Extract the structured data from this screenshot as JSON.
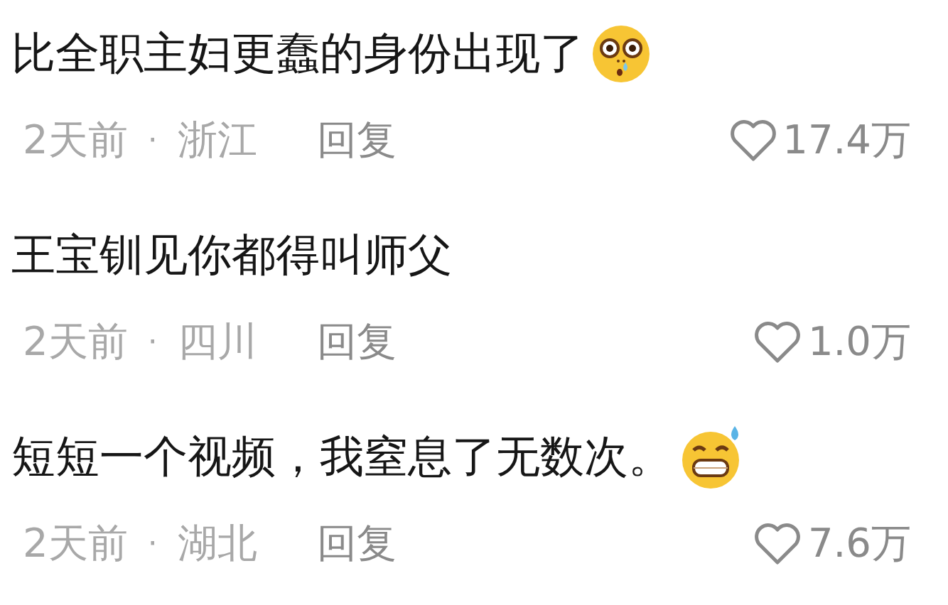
{
  "comments": [
    {
      "text": "比全职主妇更蠢的身份出现了",
      "time": "2天前",
      "separator": "·",
      "location": "浙江",
      "reply": "回复",
      "likes": "17.4万"
    },
    {
      "text": "王宝钏见你都得叫师父",
      "time": "2天前",
      "separator": "·",
      "location": "四川",
      "reply": "回复",
      "likes": "1.0万"
    },
    {
      "text": "短短一个视频，我窒息了无数次。",
      "time": "2天前",
      "separator": "·",
      "location": "湖北",
      "reply": "回复",
      "likes": "7.6万"
    }
  ]
}
